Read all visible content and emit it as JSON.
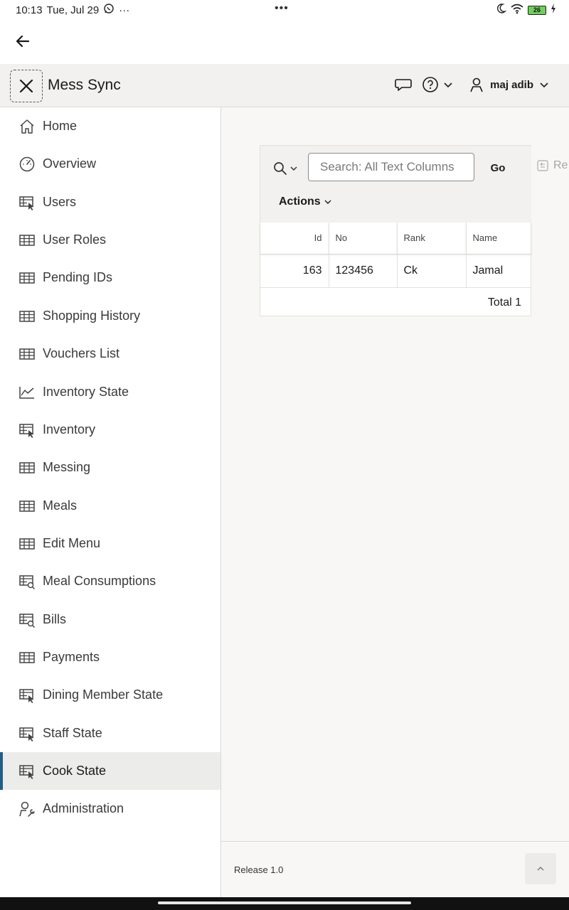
{
  "status_bar": {
    "time": "10:13",
    "date": "Tue, Jul 29",
    "more": "···",
    "center_dots": "•••",
    "battery": "26"
  },
  "header": {
    "app_title": "Mess Sync",
    "user_name": "maj adib"
  },
  "sidebar": {
    "items": [
      {
        "label": "Home",
        "icon": "home-icon"
      },
      {
        "label": "Overview",
        "icon": "dashboard-gauge-icon"
      },
      {
        "label": "Users",
        "icon": "table-pointer-icon"
      },
      {
        "label": "User Roles",
        "icon": "table-icon"
      },
      {
        "label": "Pending IDs",
        "icon": "table-icon"
      },
      {
        "label": "Shopping History",
        "icon": "table-icon"
      },
      {
        "label": "Vouchers List",
        "icon": "table-icon"
      },
      {
        "label": "Inventory State",
        "icon": "line-chart-icon"
      },
      {
        "label": "Inventory",
        "icon": "table-pointer-icon"
      },
      {
        "label": "Messing",
        "icon": "table-icon"
      },
      {
        "label": "Meals",
        "icon": "table-icon"
      },
      {
        "label": "Edit Menu",
        "icon": "table-icon"
      },
      {
        "label": "Meal Consumptions",
        "icon": "table-search-icon"
      },
      {
        "label": "Bills",
        "icon": "table-search-icon"
      },
      {
        "label": "Payments",
        "icon": "table-icon"
      },
      {
        "label": "Dining Member State",
        "icon": "table-pointer-icon"
      },
      {
        "label": "Staff State",
        "icon": "table-pointer-icon"
      },
      {
        "label": "Cook State",
        "icon": "table-pointer-icon",
        "active": true
      },
      {
        "label": "Administration",
        "icon": "user-wrench-icon"
      }
    ]
  },
  "report": {
    "search": {
      "placeholder": "Search: All Text Columns",
      "value": ""
    },
    "go_label": "Go",
    "actions_label": "Actions",
    "rest_label": "Re",
    "columns": [
      "Id",
      "No",
      "Rank",
      "Name"
    ],
    "rows": [
      [
        "163",
        "123456",
        "Ck",
        "Jamal"
      ]
    ],
    "total_label": "Total 1"
  },
  "footer": {
    "release": "Release 1.0"
  },
  "colors": {
    "accent": "#1f5f8b",
    "active_bg": "#ececea",
    "header_bg": "#f2f1ef"
  }
}
